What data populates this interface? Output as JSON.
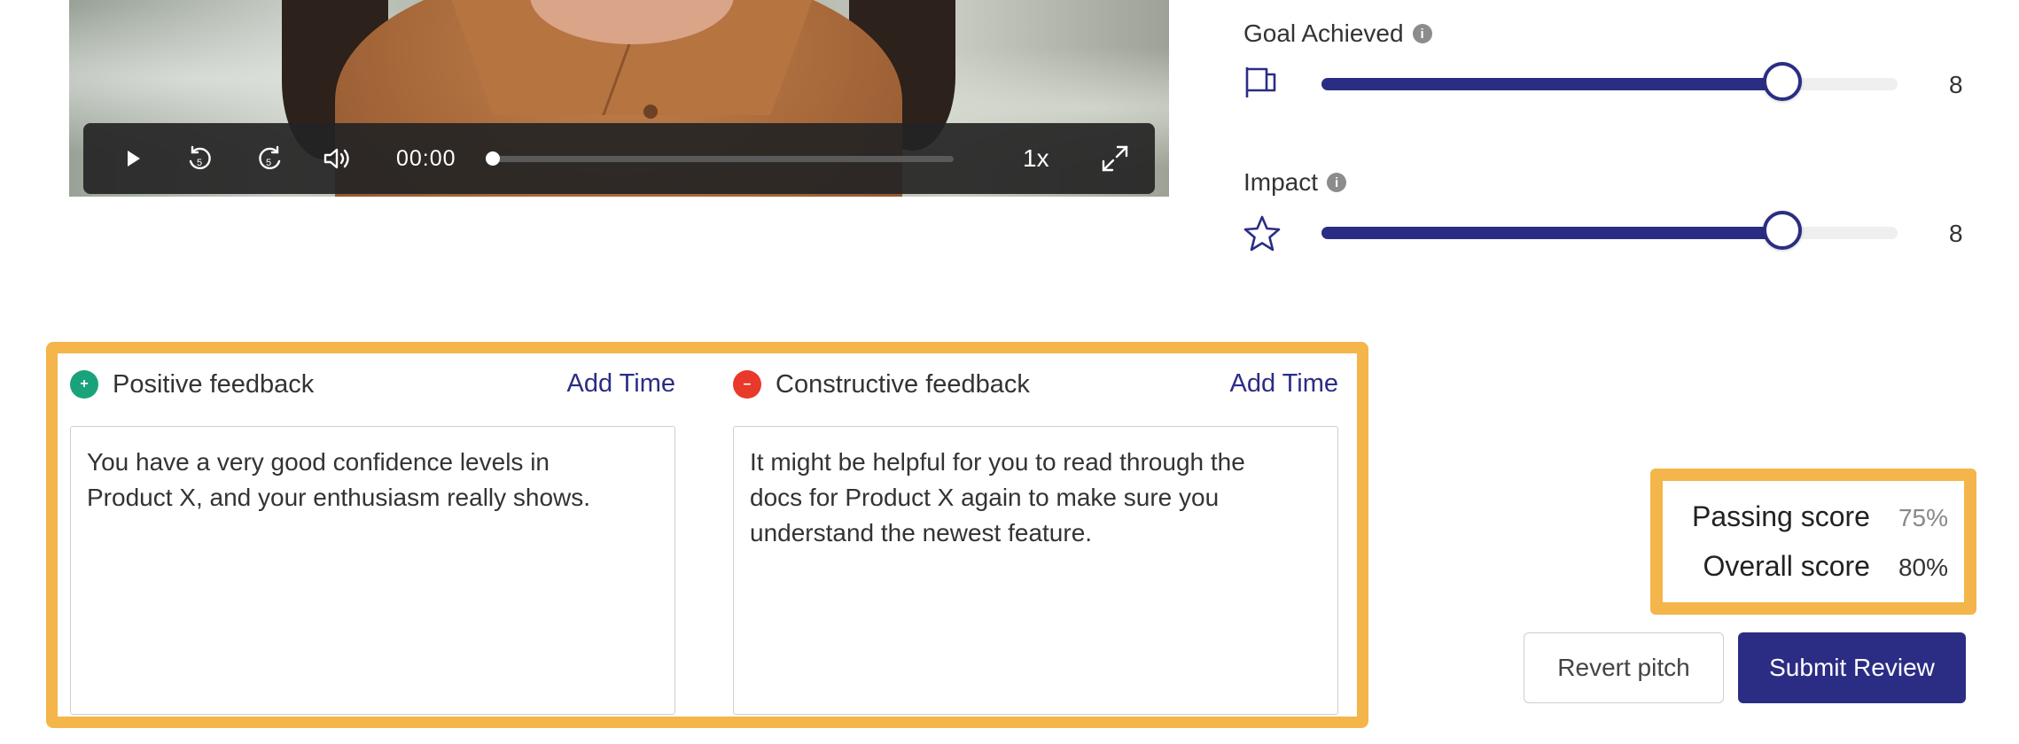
{
  "video": {
    "time": "00:00",
    "speed": "1x",
    "progress": 0,
    "controls": {
      "play": "play-icon",
      "rewind": "rewind-5-icon",
      "forward": "forward-5-icon",
      "volume": "volume-icon",
      "fullscreen": "fullscreen-icon"
    }
  },
  "metrics": [
    {
      "label": "Goal Achieved",
      "info": "i",
      "icon": "flag-icon",
      "value": "8",
      "fraction": 0.8
    },
    {
      "label": "Impact",
      "info": "i",
      "icon": "star-icon",
      "value": "8",
      "fraction": 0.8
    }
  ],
  "feedback": {
    "positive": {
      "title": "Positive feedback",
      "icon": "plus-circle-icon",
      "icon_symbol": "+",
      "add_time": "Add Time",
      "text": "You have a very good confidence levels in\nProduct X, and your enthusiasm really shows."
    },
    "constructive": {
      "title": "Constructive feedback",
      "icon": "minus-circle-icon",
      "icon_symbol": "–",
      "add_time": "Add Time",
      "text": "It might be helpful for you to read through the\ndocs for Product X again to make sure you\nunderstand the newest feature."
    }
  },
  "scores": {
    "passing_label": "Passing score",
    "passing_value": "75%",
    "overall_label": "Overall score",
    "overall_value": "80%"
  },
  "buttons": {
    "revert": "Revert pitch",
    "submit": "Submit Review"
  },
  "colors": {
    "accent": "#2b2d84",
    "highlight": "#f4b54a",
    "positive": "#1aa37a",
    "negative": "#e8392a"
  }
}
